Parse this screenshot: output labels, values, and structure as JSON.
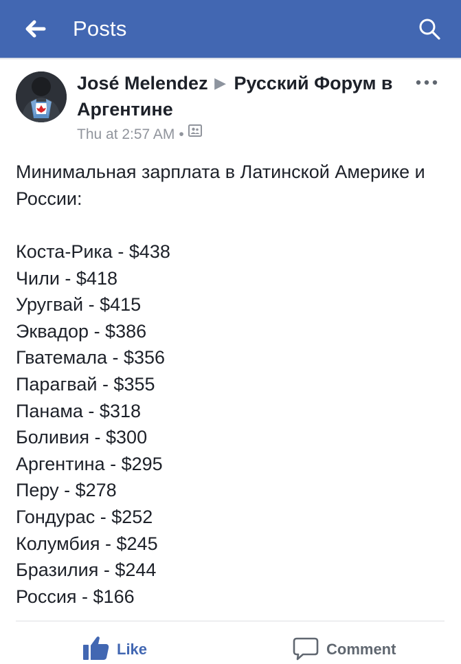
{
  "header": {
    "title": "Posts",
    "back_icon": "arrow-left-icon",
    "search_icon": "search-icon",
    "bg_color": "#4267b2"
  },
  "post": {
    "author": "José Melendez",
    "group": "Русский Форум в Аргентине",
    "timestamp": "Thu at 2:57 AM",
    "separator": "•",
    "audience_icon": "group-audience-icon",
    "intro": "Минимальная зарплата в Латинской Америке и России:",
    "items": [
      "Коста-Рика - $438",
      "Чили - $418",
      "Уругвай - $415",
      "Эквадор - $386",
      "Гватемала - $356",
      "Парагвай - $355",
      "Панама - $318",
      "Боливия - $300",
      "Аргентина - $295",
      "Перу - $278",
      "Гондурас - $252",
      "Колумбия - $245",
      "Бразилия - $244",
      "Россия - $166"
    ]
  },
  "actions": {
    "like": "Like",
    "comment": "Comment",
    "like_color": "#4267b2"
  }
}
